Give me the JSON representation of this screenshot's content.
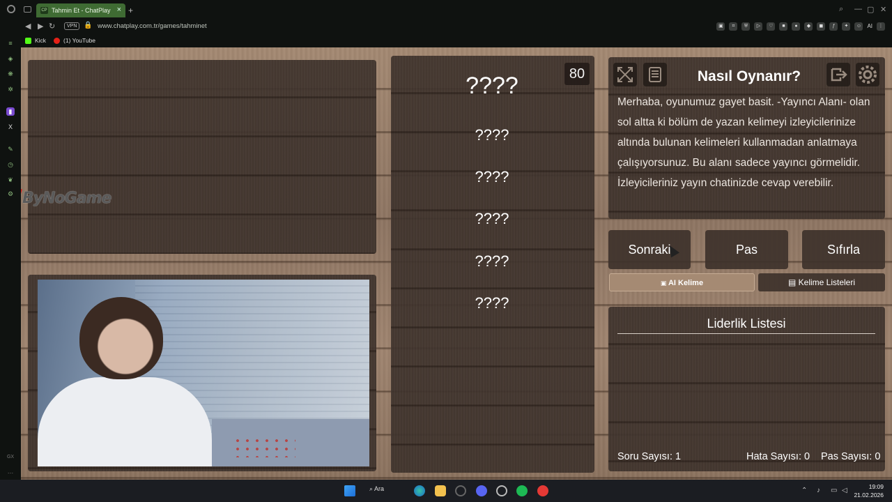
{
  "browser": {
    "tab_title": "Tahmin Et - ChatPlay",
    "tab_favicon": "CP",
    "vpn_label": "VPN",
    "url": "www.chatplay.com.tr/games/tahminet",
    "bookmarks": [
      "Kick",
      "(1) YouTube"
    ],
    "ai_label": "AI"
  },
  "overlay": {
    "logo_text": "ByNoGame"
  },
  "game": {
    "timer": "80",
    "main_word": "????",
    "words": [
      "????",
      "????",
      "????",
      "????",
      "????"
    ]
  },
  "howto": {
    "title": "Nasıl Oynanır?",
    "text": "Merhaba, oyunumuz gayet basit. -Yayıncı Alanı- olan sol altta ki bölüm de yazan kelimeyi izleyicilerinize altında bulunan kelimeleri kullanmadan anlatmaya çalışıyorsunuz. Bu alanı sadece yayıncı görmelidir. İzleyicileriniz yayın chatinizde cevap verebilir."
  },
  "controls": {
    "next": "Sonraki",
    "pass": "Pas",
    "reset": "Sıfırla",
    "ai_word": "AI Kelime",
    "word_lists": "Kelime Listeleri"
  },
  "leaderboard": {
    "title": "Liderlik Listesi"
  },
  "stats": {
    "questions": "Soru Sayısı: 1",
    "errors": "Hata Sayısı: 0",
    "passes": "Pas Sayısı: 0"
  },
  "taskbar": {
    "search": "Ara",
    "time": "19:09",
    "date": "21.02.2026"
  },
  "colors": {
    "panel": "#3e322b",
    "accent_button": "#a58a73",
    "tab_green": "#3f6b33"
  }
}
